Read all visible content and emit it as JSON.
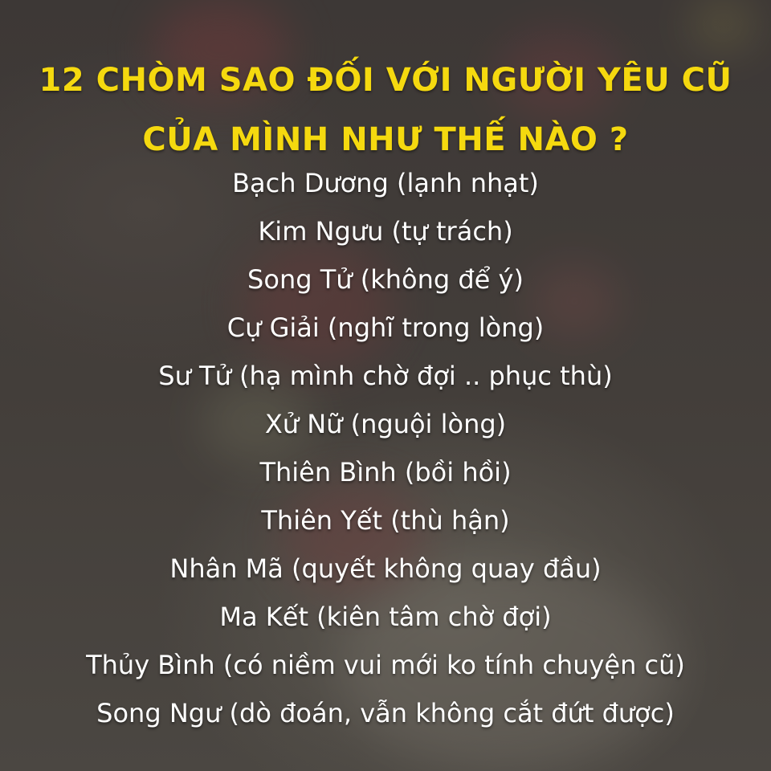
{
  "title": {
    "line1": "12 CHÒM SAO ĐỐI VỚI NGƯỜI YÊU CŨ",
    "line2": "CỦA MÌNH NHƯ THẾ NÀO ?"
  },
  "items": [
    "Bạch Dương (lạnh nhạt)",
    "Kim Ngưu (tự trách)",
    "Song Tử (không để ý)",
    "Cự Giải (nghĩ trong lòng)",
    "Sư Tử (hạ mình chờ đợi .. phục thù)",
    "Xử Nữ (nguội lòng)",
    "Thiên Bình (bồi hồi)",
    "Thiên Yết (thù hận)",
    "Nhân Mã (quyết không quay đầu)",
    "Ma Kết (kiên tâm chờ đợi)",
    "Thủy Bình (có niềm vui mới ko tính chuyện cũ)",
    "Song Ngư (dò đoán, vẫn không cắt đứt được)"
  ],
  "colors": {
    "title": "#f5d90f",
    "text": "#ffffff",
    "background": "#3b3734"
  }
}
